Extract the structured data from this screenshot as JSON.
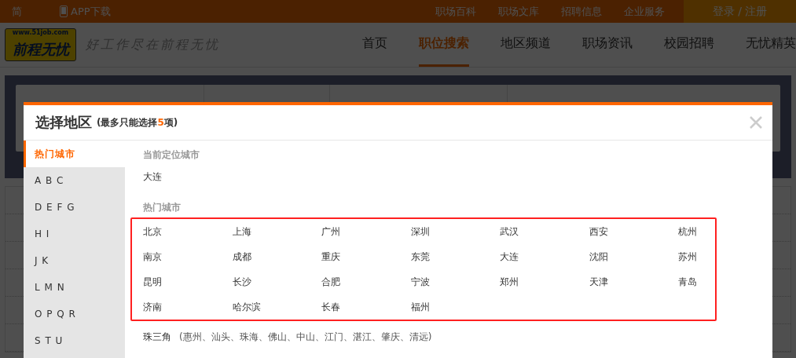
{
  "top_bar": {
    "lang": "简",
    "app": "APP下载",
    "links": [
      "职场百科",
      "职场文库",
      "招聘信息",
      "企业服务"
    ],
    "login": "登录 / 注册"
  },
  "header": {
    "logo_url": "www.51job.com",
    "logo_text": "前程无忧",
    "slogan": "好工作尽在前程无忧",
    "nav": [
      {
        "label": "首页",
        "selected": false
      },
      {
        "label": "职位搜索",
        "selected": true
      },
      {
        "label": "地区频道",
        "selected": false
      },
      {
        "label": "职场资讯",
        "selected": false
      },
      {
        "label": "校园招聘",
        "selected": false
      },
      {
        "label": "无忧精英",
        "selected": false
      }
    ]
  },
  "dialog": {
    "title": "选择地区",
    "note": "(最多只能选择**5**项)",
    "sidebar": [
      {
        "label": "热门城市",
        "selected": true
      },
      {
        "label": "A B C",
        "selected": false
      },
      {
        "label": "D E F G",
        "selected": false
      },
      {
        "label": "H I",
        "selected": false
      },
      {
        "label": "J K",
        "selected": false
      },
      {
        "label": "L M N",
        "selected": false
      },
      {
        "label": "O P Q R",
        "selected": false
      },
      {
        "label": "S T U",
        "selected": false
      }
    ],
    "current_heading": "当前定位城市",
    "current_city": "大连",
    "hot_heading": "热门城市",
    "hot_cities": [
      "北京",
      "上海",
      "广州",
      "深圳",
      "武汉",
      "西安",
      "杭州",
      "南京",
      "成都",
      "重庆",
      "东莞",
      "大连",
      "沈阳",
      "苏州",
      "昆明",
      "长沙",
      "合肥",
      "宁波",
      "郑州",
      "天津",
      "青岛",
      "济南",
      "哈尔滨",
      "长春",
      "福州"
    ],
    "region": {
      "name": "珠三角",
      "cities": "(惠州、汕头、珠海、佛山、中山、江门、湛江、肇庆、清远)"
    }
  }
}
